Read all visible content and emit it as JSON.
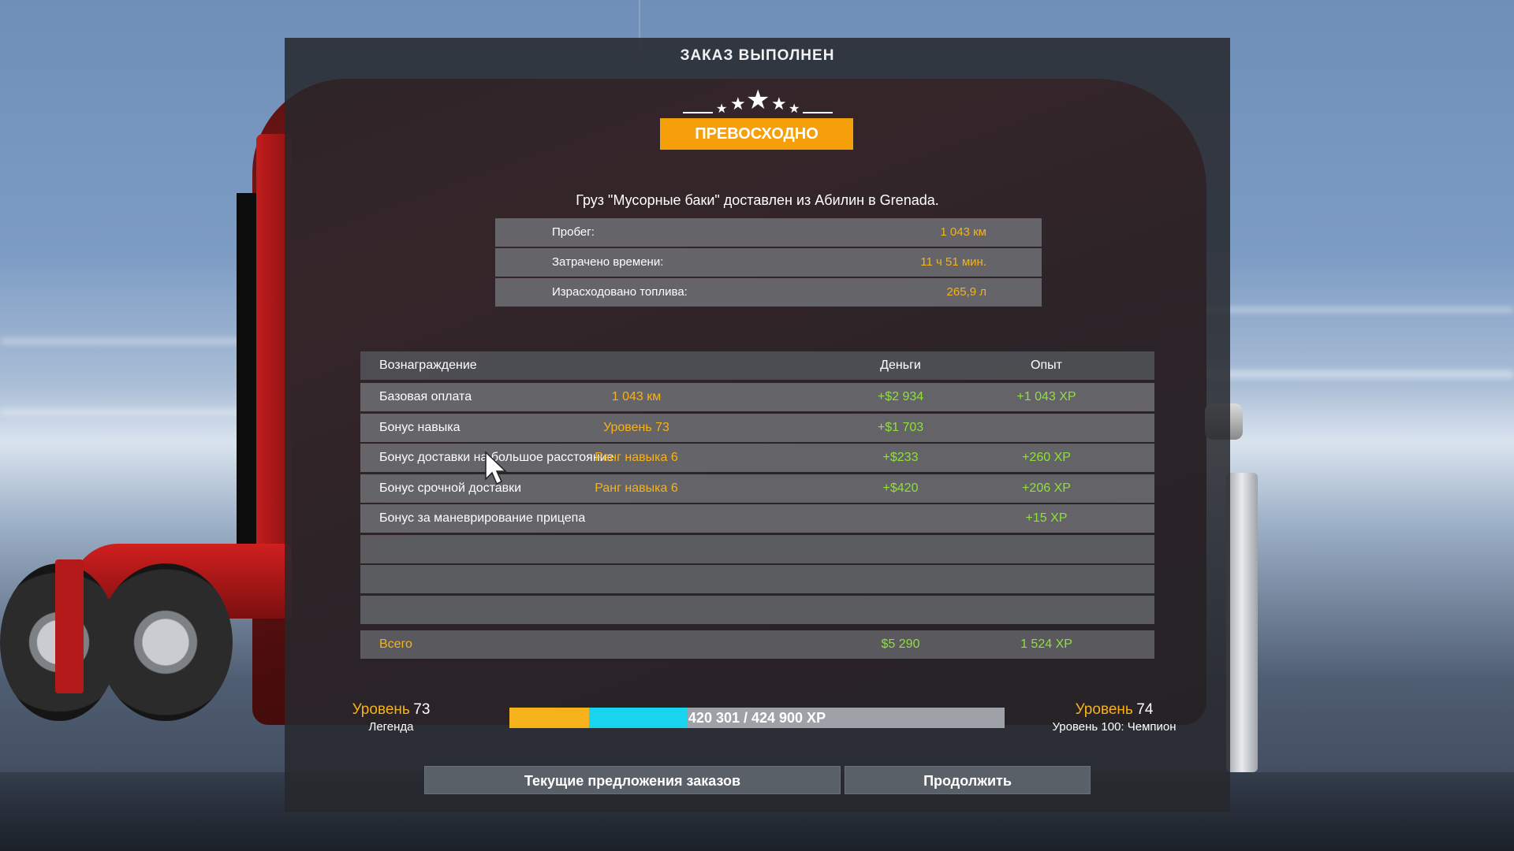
{
  "window": {
    "title": "ЗАКАЗ ВЫПОЛНЕН"
  },
  "rating": {
    "stars_icon": "star-icon",
    "grade": "ПРЕВОСХОДНО",
    "grade_color": "#f5a00a"
  },
  "cargo": {
    "summary": "Груз \"Мусорные баки\" доставлен из Абилин в Grenada."
  },
  "stats": [
    {
      "label": "Пробег:",
      "value": "1 043 км"
    },
    {
      "label": "Затрачено времени:",
      "value": "11 ч 51 мин."
    },
    {
      "label": "Израсходовано топлива:",
      "value": "265,9 л"
    }
  ],
  "rewards": {
    "headers": {
      "name": "Вознаграждение",
      "money": "Деньги",
      "xp": "Опыт"
    },
    "rows": [
      {
        "name": "Базовая оплата",
        "detail": "1 043 км",
        "money": "+$2 934",
        "xp": "+1 043 XP"
      },
      {
        "name": "Бонус навыка",
        "detail": "Уровень 73",
        "money": "+$1 703",
        "xp": ""
      },
      {
        "name": "Бонус доставки на большое расстояние",
        "detail": "Ранг навыка 6",
        "money": "+$233",
        "xp": "+260 XP"
      },
      {
        "name": "Бонус срочной доставки",
        "detail": "Ранг навыка 6",
        "money": "+$420",
        "xp": "+206 XP"
      },
      {
        "name": "Бонус за маневрирование прицепа",
        "detail": "",
        "money": "",
        "xp": "+15 XP"
      }
    ],
    "total": {
      "name": "Всего",
      "money": "$5 290",
      "xp": "1 524 XP"
    }
  },
  "level": {
    "current_word": "Уровень",
    "current_num": "73",
    "current_title": "Легенда",
    "next_word": "Уровень",
    "next_num": "74",
    "next_note": "Уровень 100: Чемпион",
    "xp_text": "420 301 / 424 900 XP",
    "xp_before_fraction": 0.1605,
    "xp_after_fraction": 0.3585,
    "colors": {
      "old": "#f5b21a",
      "new": "#19d4ef",
      "empty": "#9ea2a8"
    }
  },
  "buttons": {
    "offers": "Текущие предложения заказов",
    "continue": "Продолжить"
  },
  "colors": {
    "accent": "#f5b21a",
    "positive": "#8ee03a"
  }
}
